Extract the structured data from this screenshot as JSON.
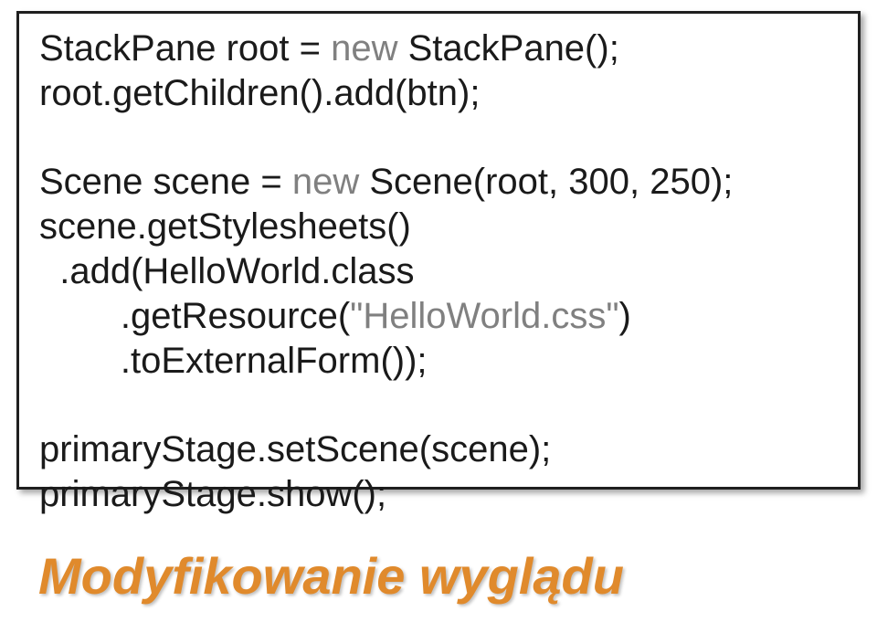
{
  "code": {
    "l1a": "StackPane root = ",
    "l1b": "new",
    "l1c": " StackPane();",
    "l2": "root.getChildren().add(btn);",
    "blank1": "",
    "l3a": "Scene scene = ",
    "l3b": "new",
    "l3c": " Scene(root, 300, 250);",
    "l4": "scene.getStylesheets()",
    "l5": "  .add(HelloWorld.class",
    "l6a": "        .getResource(",
    "l6b": "\"HelloWorld.css\"",
    "l6c": ")",
    "l7": "        .toExternalForm());",
    "blank2": "",
    "l8": "primaryStage.setScene(scene);",
    "l9": "primaryStage.show();"
  },
  "heading": "Modyfikowanie wyglądu"
}
